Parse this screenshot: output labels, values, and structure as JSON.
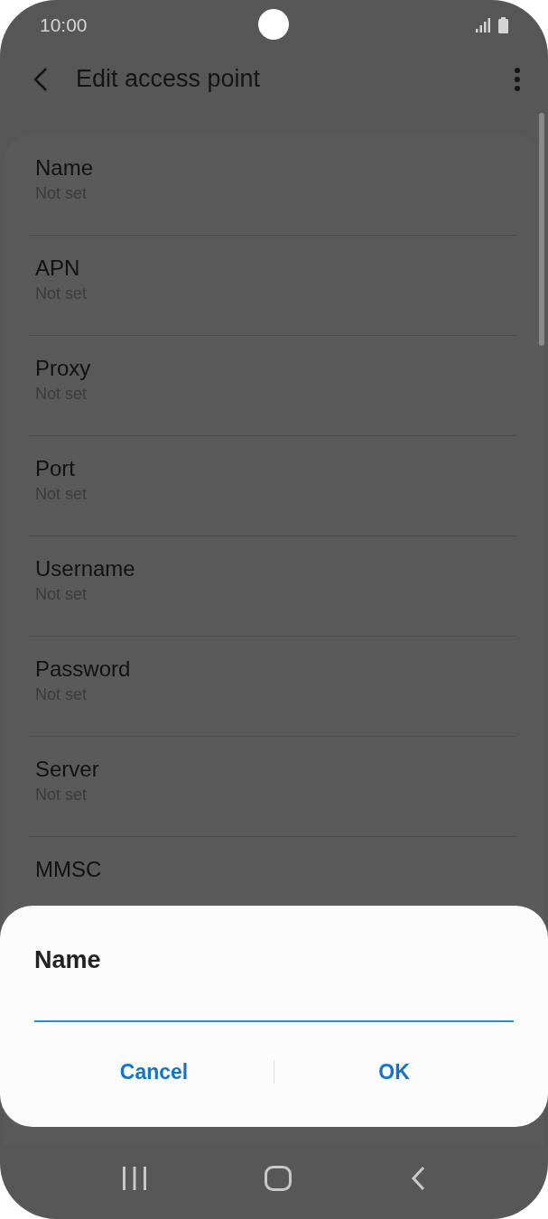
{
  "status_bar": {
    "time": "10:00"
  },
  "header": {
    "title": "Edit access point"
  },
  "settings": [
    {
      "label": "Name",
      "value": "Not set"
    },
    {
      "label": "APN",
      "value": "Not set"
    },
    {
      "label": "Proxy",
      "value": "Not set"
    },
    {
      "label": "Port",
      "value": "Not set"
    },
    {
      "label": "Username",
      "value": "Not set"
    },
    {
      "label": "Password",
      "value": "Not set"
    },
    {
      "label": "Server",
      "value": "Not set"
    },
    {
      "label": "MMSC"
    }
  ],
  "dialog": {
    "title": "Name",
    "buttons": [
      "Cancel",
      "OK"
    ]
  }
}
